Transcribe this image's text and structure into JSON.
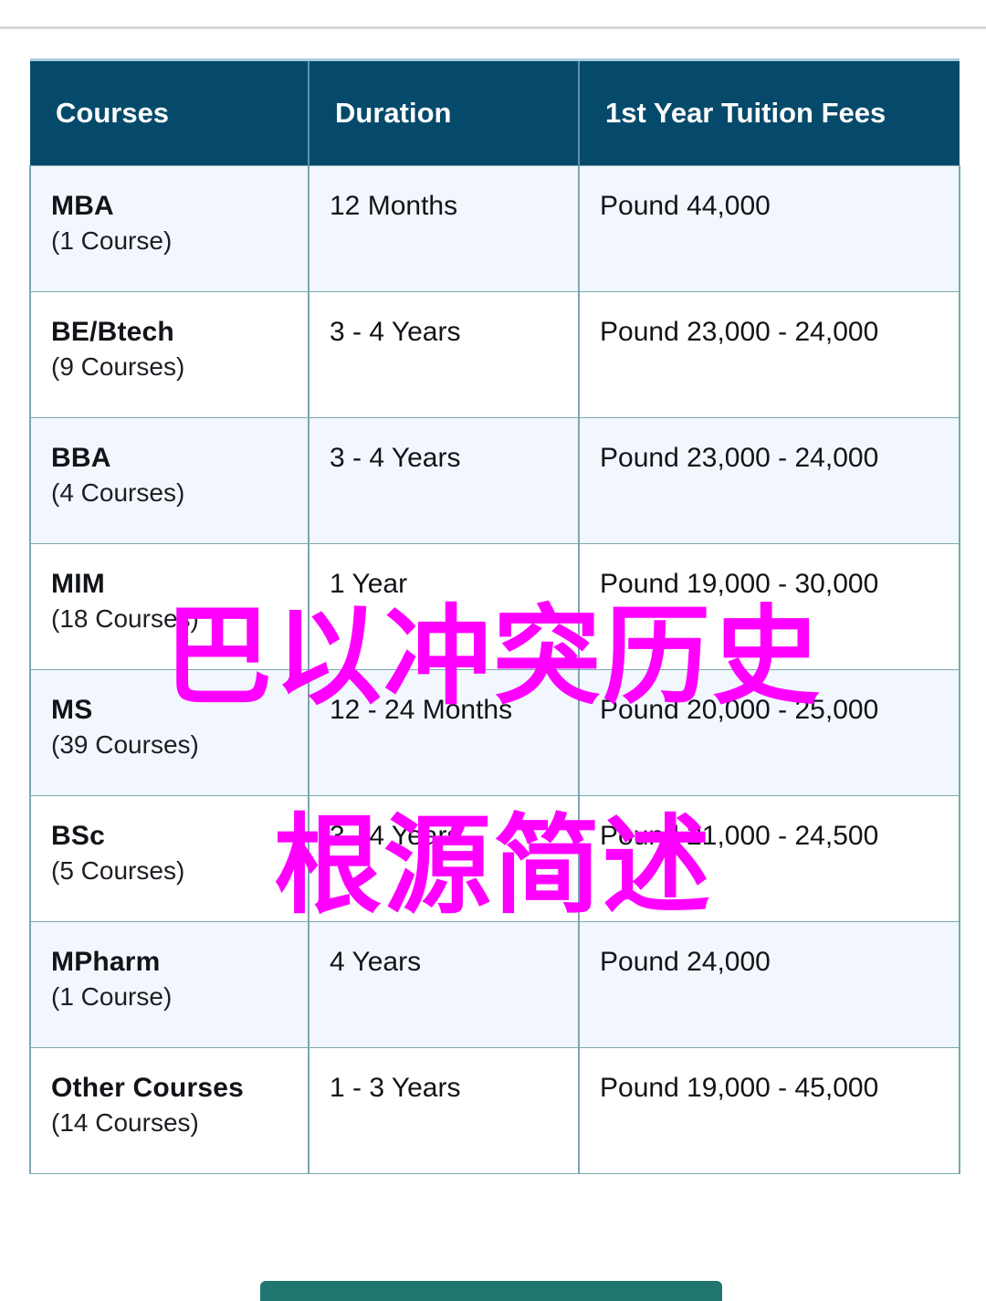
{
  "page": {
    "overlay_line_1": "巴以冲突历史",
    "overlay_line_2": "根源简述",
    "overlay_color": "#FF00FF",
    "header_bg_color": "#054A6B",
    "row_tint_color": "#F2F7FD",
    "border_color": "#7BA7B0",
    "button_color": "#21756F"
  },
  "table": {
    "columns": [
      {
        "label": "Courses"
      },
      {
        "label": "Duration"
      },
      {
        "label": "1st Year Tuition Fees"
      }
    ],
    "rows": [
      {
        "course": "MBA",
        "count": "(1 Course)",
        "duration": "12 Months",
        "fees": "Pound 44,000"
      },
      {
        "course": "BE/Btech",
        "count": "(9 Courses)",
        "duration": "3 - 4 Years",
        "fees": "Pound 23,000 - 24,000"
      },
      {
        "course": "BBA",
        "count": "(4 Courses)",
        "duration": "3 - 4 Years",
        "fees": "Pound 23,000 - 24,000"
      },
      {
        "course": "MIM",
        "count": "(18 Courses)",
        "duration": "1 Year",
        "fees": "Pound 19,000 - 30,000"
      },
      {
        "course": "MS",
        "count": "(39 Courses)",
        "duration": "12 - 24 Months",
        "fees": "Pound 20,000 - 25,000"
      },
      {
        "course": "BSc",
        "count": "(5 Courses)",
        "duration": "3 - 4 Years",
        "fees": "Pound 21,000 - 24,500"
      },
      {
        "course": "MPharm",
        "count": "(1 Course)",
        "duration": "4 Years",
        "fees": "Pound 24,000"
      },
      {
        "course": "Other Courses",
        "count": "(14 Courses)",
        "duration": "1 - 3 Years",
        "fees": "Pound 19,000 - 45,000"
      }
    ]
  }
}
